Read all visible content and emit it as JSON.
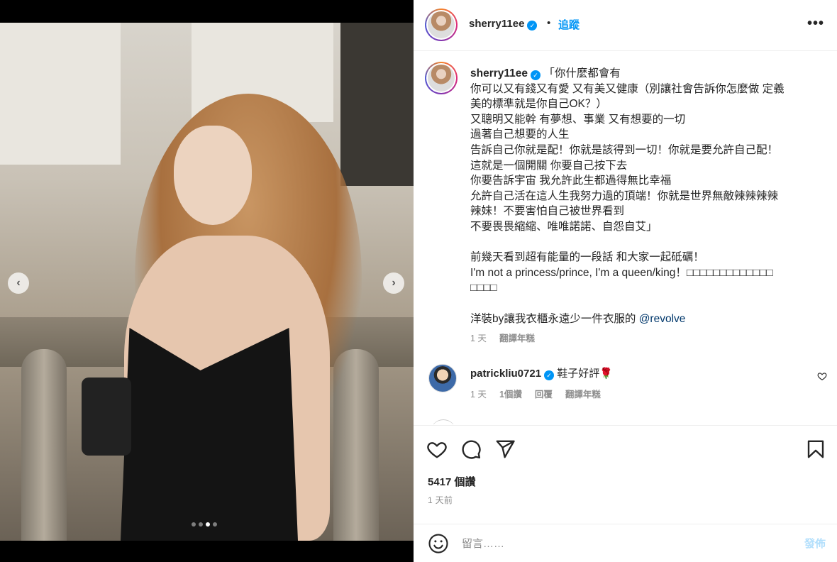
{
  "header": {
    "username": "sherry11ee",
    "separator": "•",
    "follow_label": "追蹤",
    "more_label": "•••"
  },
  "caption": {
    "username": "sherry11ee",
    "lines": [
      "「你什麼都會有",
      "你可以又有錢又有愛 又有美又健康（別讓社會告訴你怎麼做 定義",
      "美的標準就是你自己OK？）",
      "又聰明又能幹 有夢想、事業 又有想要的一切",
      "過著自己想要的人生",
      "告訴自己你就是配！你就是該得到一切！你就是要允許自己配！",
      "這就是一個開關 你要自己按下去",
      "你要告訴宇宙 我允許此生都過得無比幸福",
      "允許自己活在這人生我努力過的頂端！你就是世界無敵辣辣辣辣",
      "辣妹！不要害怕自己被世界看到",
      "不要畏畏縮縮、唯唯諾諾、自怨自艾」",
      "",
      "前幾天看到超有能量的一段話 和大家一起砥礪！",
      "I'm not a princess/prince, I'm a queen/king！□□□□□□□□□□□□□",
      "□□□□",
      ""
    ],
    "last_line_prefix": "洋裝by讓我衣櫃永遠少一件衣服的 ",
    "mention": "@revolve",
    "time": "1 天",
    "translate": "翻譯年糕"
  },
  "comment": {
    "username": "patrickliu0721",
    "text": "鞋子好評",
    "emoji": "🌹",
    "time": "1 天",
    "likes": "1個讚",
    "reply": "回覆",
    "translate": "翻譯年糕"
  },
  "actions": {
    "like_icon": "heart-icon",
    "comment_icon": "comment-icon",
    "share_icon": "share-icon",
    "save_icon": "bookmark-icon"
  },
  "likes_count": "5417 個讚",
  "post_time": "1 天前",
  "composer": {
    "placeholder": "留言……",
    "post_label": "發佈"
  },
  "carousel": {
    "prev": "‹",
    "next": "›",
    "slide_count": 4,
    "active_index": 2
  }
}
